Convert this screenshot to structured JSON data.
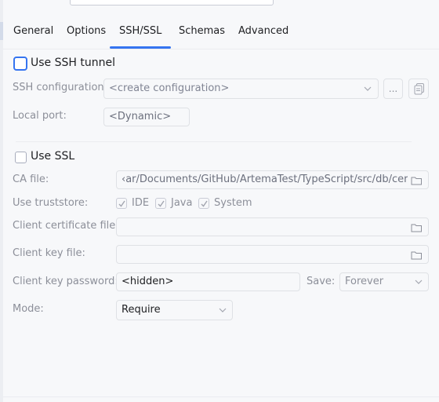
{
  "tabs": [
    {
      "label": "General"
    },
    {
      "label": "Options"
    },
    {
      "label": "SSH/SSL"
    },
    {
      "label": "Schemas"
    },
    {
      "label": "Advanced"
    }
  ],
  "active_tab": "SSH/SSL",
  "ssh": {
    "tunnel_label": "Use SSH tunnel",
    "tunnel_checked": false,
    "config_label": "SSH configuration:",
    "config_value": "<create configuration>",
    "more_button": "...",
    "port_label": "Local port:",
    "port_value": "<Dynamic>"
  },
  "ssl": {
    "use_label": "Use SSL",
    "use_checked": false,
    "ca_label": "CA file:",
    "ca_value": "‹ar/Documents/GitHub/ArtemaTest/TypeScript/src/db/cert/ca.crt",
    "truststore_label": "Use truststore:",
    "truststore_options": [
      {
        "label": "IDE",
        "checked": true
      },
      {
        "label": "Java",
        "checked": true
      },
      {
        "label": "System",
        "checked": true
      }
    ],
    "client_cert_label": "Client certificate file:",
    "client_cert_value": "",
    "client_key_label": "Client key file:",
    "client_key_value": "",
    "key_password_label": "Client key password:",
    "key_password_value": "<hidden>",
    "save_label": "Save:",
    "save_value": "Forever",
    "mode_label": "Mode:",
    "mode_value": "Require"
  },
  "colors": {
    "accent": "#3574f0",
    "label": "#8c8f99",
    "background": "#f7f8fa"
  },
  "icons": [
    "folder-icon",
    "copy-icon",
    "chevron-down-icon",
    "checkmark-icon"
  ]
}
